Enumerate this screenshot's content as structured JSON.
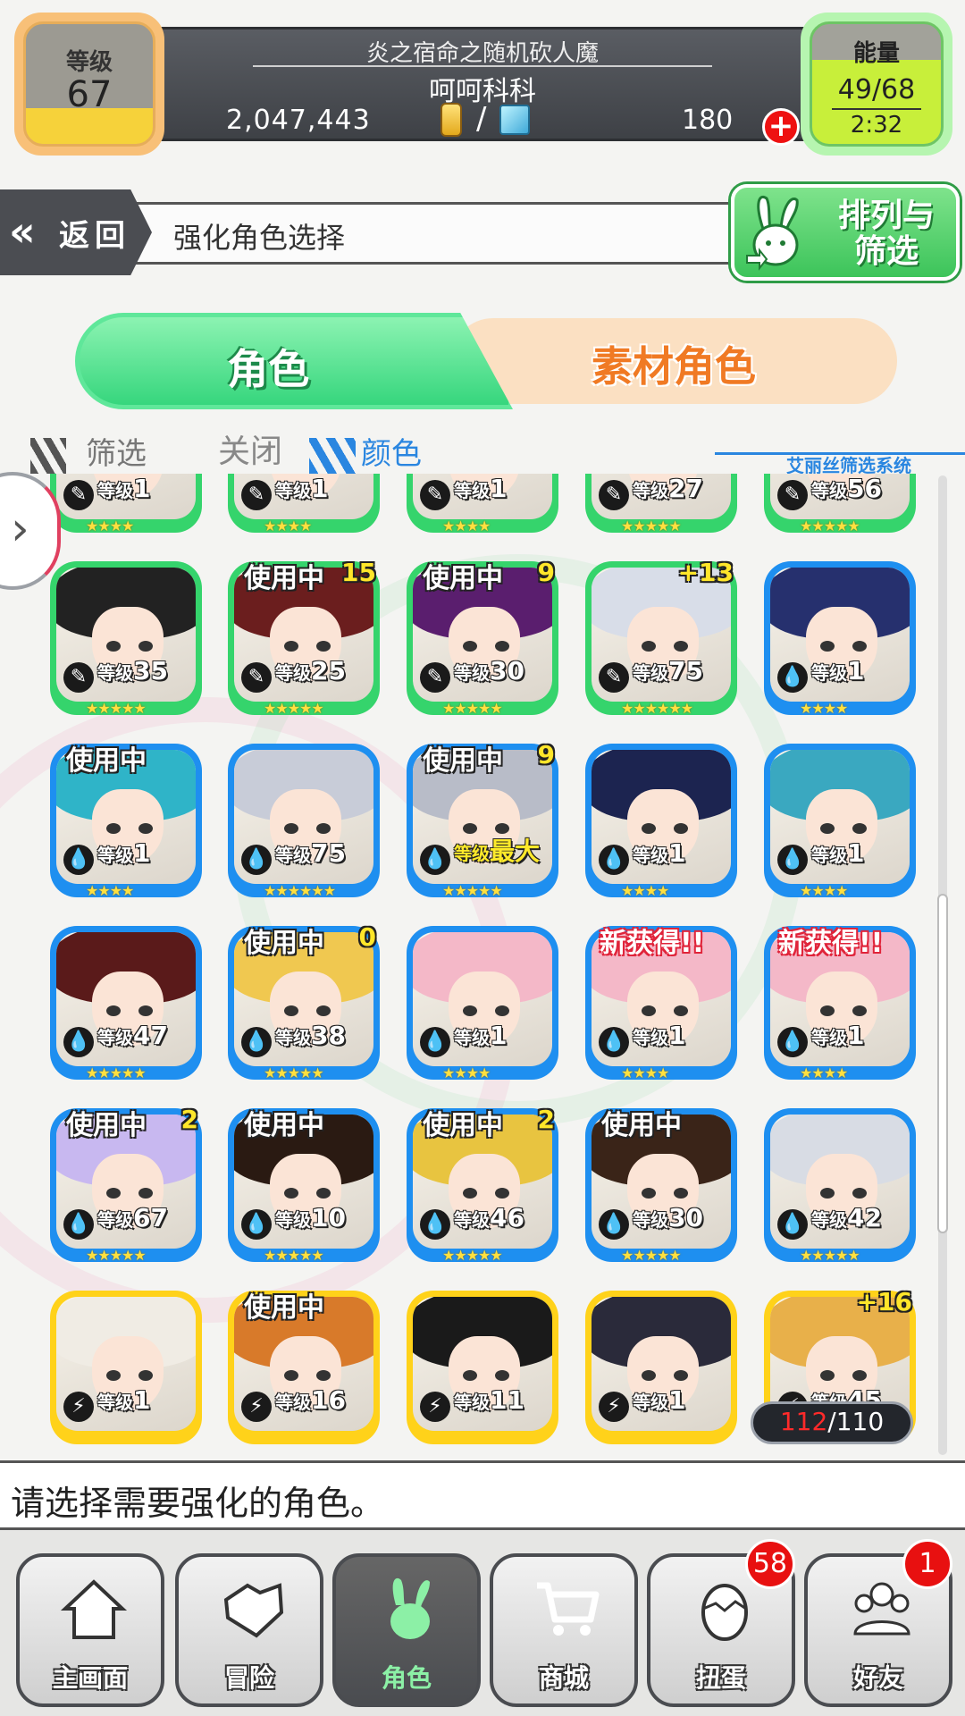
{
  "header": {
    "guild_name": "炎之宿命之随机砍人魔",
    "player_name": "呵呵科科",
    "gold": "2,047,443",
    "gold_separator": "/",
    "gems": "180",
    "level_label": "等级",
    "level": "67",
    "energy_label": "能量",
    "energy": "49/68",
    "energy_timer": "2:32"
  },
  "titlebar": {
    "back_label": "返回",
    "title": "强化角色选择",
    "sort_label": "排列与筛选"
  },
  "tabs": {
    "character": "角色",
    "material": "素材角色"
  },
  "filter": {
    "label": "筛选",
    "off": "关闭",
    "color": "颜色",
    "system": "艾丽丝筛选系统"
  },
  "colors": {
    "green": "#35d46c",
    "blue": "#1e8ff0",
    "yellow": "#ffd21a",
    "accent_blue": "#2a86e0",
    "new_red": "#e0243a"
  },
  "cards": [
    {
      "frame": "green",
      "level": "1",
      "stars": "★★★★",
      "hair": "#3b6b4a"
    },
    {
      "frame": "green",
      "level": "1",
      "stars": "★★★★",
      "hair": "#e8c35a"
    },
    {
      "frame": "green",
      "level": "1",
      "stars": "★★★★",
      "hair": "#2b2b2b"
    },
    {
      "frame": "green",
      "level": "27",
      "stars": "★★★★★",
      "hair": "#d9542a"
    },
    {
      "frame": "green",
      "level": "56",
      "stars": "★★★★★",
      "hair": "#f0c880"
    },
    {
      "frame": "green",
      "level": "35",
      "stars": "★★★★★",
      "hair": "#222"
    },
    {
      "frame": "green",
      "level": "25",
      "stars": "★★★★★",
      "hair": "#6b1e1e",
      "inuse": "使用中",
      "plus": "15"
    },
    {
      "frame": "green",
      "level": "30",
      "stars": "★★★★★",
      "hair": "#5a1e6e",
      "inuse": "使用中",
      "plus": "9"
    },
    {
      "frame": "green",
      "level": "75",
      "stars": "★★★★★★",
      "hair": "#d8dde8",
      "plus": "+13"
    },
    {
      "frame": "blue",
      "level": "1",
      "stars": "★★★★",
      "hair": "#26306e"
    },
    {
      "frame": "blue",
      "level": "1",
      "stars": "★★★★",
      "hair": "#2fb4c8",
      "inuse": "使用中"
    },
    {
      "frame": "blue",
      "level": "75",
      "stars": "★★★★★★",
      "hair": "#c8ccd8"
    },
    {
      "frame": "blue",
      "level": "最大",
      "stars": "★★★★★",
      "hair": "#b8bcc8",
      "inuse": "使用中",
      "plus": "9",
      "max": true
    },
    {
      "frame": "blue",
      "level": "1",
      "stars": "★★★★",
      "hair": "#1c2450"
    },
    {
      "frame": "blue",
      "level": "1",
      "stars": "★★★★",
      "hair": "#3aa8c0"
    },
    {
      "frame": "blue",
      "level": "47",
      "stars": "★★★★★",
      "hair": "#5a1a1a"
    },
    {
      "frame": "blue",
      "level": "38",
      "stars": "★★★★★",
      "hair": "#f0c850",
      "inuse": "使用中",
      "plus": "0"
    },
    {
      "frame": "blue",
      "level": "1",
      "stars": "★★★★",
      "hair": "#f4b8c8"
    },
    {
      "frame": "blue",
      "level": "1",
      "stars": "★★★★",
      "hair": "#f4b8c8",
      "new": "新获得!!"
    },
    {
      "frame": "blue",
      "level": "1",
      "stars": "★★★★",
      "hair": "#f4b8c8",
      "new": "新获得!!"
    },
    {
      "frame": "blue",
      "level": "67",
      "stars": "★★★★★",
      "hair": "#c8b8f0",
      "inuse": "使用中",
      "plus": "2"
    },
    {
      "frame": "blue",
      "level": "10",
      "stars": "★★★★★",
      "hair": "#2a1a12",
      "inuse": "使用中"
    },
    {
      "frame": "blue",
      "level": "46",
      "stars": "★★★★★",
      "hair": "#e8c440",
      "inuse": "使用中",
      "plus": "2"
    },
    {
      "frame": "blue",
      "level": "30",
      "stars": "★★★★★",
      "hair": "#3a2418",
      "inuse": "使用中"
    },
    {
      "frame": "blue",
      "level": "42",
      "stars": "★★★★★",
      "hair": "#d8dce4"
    },
    {
      "frame": "yellow",
      "level": "1",
      "stars": "",
      "hair": "#f0ece4"
    },
    {
      "frame": "yellow",
      "level": "16",
      "stars": "",
      "hair": "#d87a2a",
      "inuse": "使用中"
    },
    {
      "frame": "yellow",
      "level": "11",
      "stars": "",
      "hair": "#1a1a1a"
    },
    {
      "frame": "yellow",
      "level": "1",
      "stars": "",
      "hair": "#2a2a3a"
    },
    {
      "frame": "yellow",
      "level": "45",
      "stars": "",
      "hair": "#e8b04a",
      "plus": "+16"
    }
  ],
  "level_prefix": "等级",
  "capacity": {
    "current": "112",
    "sep": "/",
    "max": "110"
  },
  "message": "请选择需要强化的角色。",
  "nav": [
    {
      "label": "主画面",
      "icon": "home-icon"
    },
    {
      "label": "冒险",
      "icon": "handshake-icon"
    },
    {
      "label": "角色",
      "icon": "bunny-icon",
      "active": true
    },
    {
      "label": "商城",
      "icon": "cart-icon"
    },
    {
      "label": "扭蛋",
      "icon": "egg-icon",
      "badge": "58"
    },
    {
      "label": "好友",
      "icon": "friends-icon",
      "badge": "1"
    }
  ]
}
